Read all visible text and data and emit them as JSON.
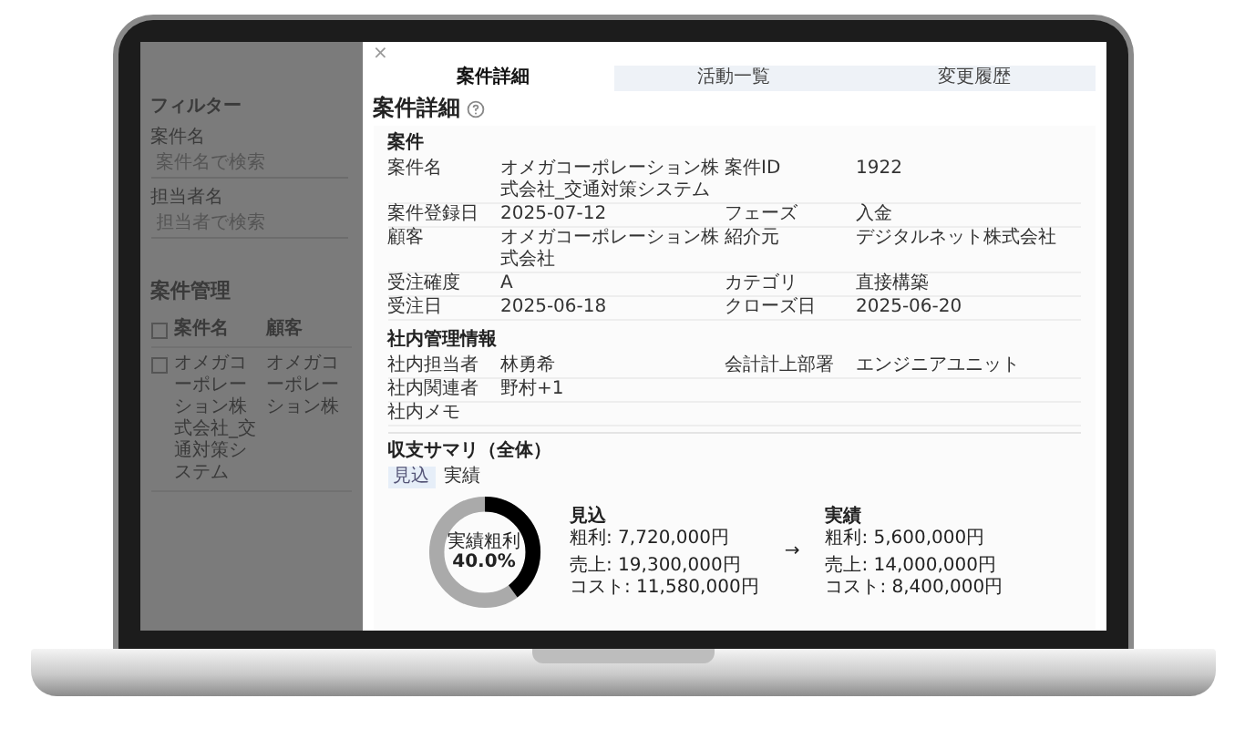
{
  "sidebar": {
    "filter_title": "フィルター",
    "filters": [
      {
        "label": "案件名",
        "placeholder": "案件名で検索"
      },
      {
        "label": "担当者名",
        "placeholder": "担当者で検索"
      }
    ],
    "list_title": "案件管理",
    "header_checked": false,
    "columns": [
      "案件名",
      "顧客"
    ],
    "rows": [
      {
        "checked": false,
        "cells": [
          "オメガコーポレーション株式会社_交通対策システム",
          "オメガコーポレーション株"
        ]
      }
    ]
  },
  "panel": {
    "close": "×",
    "tabs": [
      {
        "label": "案件詳細",
        "selected": true
      },
      {
        "label": "活動一覧",
        "selected": false
      },
      {
        "label": "変更履歴",
        "selected": false
      }
    ],
    "title": "案件詳細",
    "sections": [
      {
        "title": "案件",
        "rows": [
          [
            {
              "label": "案件名",
              "value": "オメガコーポレーション株式会社_交通対策システム"
            },
            {
              "label": "案件ID",
              "value": "1922"
            }
          ],
          [
            {
              "label": "案件登録日",
              "value": "2025-07-12"
            },
            {
              "label": "フェーズ",
              "value": "入金"
            }
          ],
          [
            {
              "label": "顧客",
              "value": "オメガコーポレーション株式会社"
            },
            {
              "label": "紹介元",
              "value": "デジタルネット株式会社"
            }
          ],
          [
            {
              "label": "受注確度",
              "value": "A"
            },
            {
              "label": "カテゴリ",
              "value": "直接構築"
            }
          ],
          [
            {
              "label": "受注日",
              "value": "2025-06-18"
            },
            {
              "label": "クローズ日",
              "value": "2025-06-20"
            }
          ]
        ]
      },
      {
        "title": "社内管理情報",
        "rows": [
          [
            {
              "label": "社内担当者",
              "value": "林勇希"
            },
            {
              "label": "会計計上部署",
              "value": "エンジニアユニット"
            }
          ],
          [
            {
              "label": "社内関連者",
              "value": "野村+1"
            }
          ],
          [
            {
              "label": "社内メモ"
            }
          ]
        ]
      }
    ],
    "summary": {
      "title": "収支サマリ（全体）",
      "toggles": [
        {
          "label": "見込",
          "selected": true
        },
        {
          "label": "実績",
          "selected": false
        }
      ],
      "gauge": {
        "label": "実績粗利",
        "reading": "40.0%",
        "level": 0.4
      },
      "arrow": "→",
      "columns": [
        {
          "title": "見込",
          "profit": "粗利: 7,720,000円",
          "sales": "売上: 19,300,000円",
          "cost": "コスト: 11,580,000円"
        },
        {
          "title": "実績",
          "profit": "粗利: 5,600,000円",
          "sales": "売上: 14,000,000円",
          "cost": "コスト: 8,400,000円"
        }
      ]
    }
  }
}
